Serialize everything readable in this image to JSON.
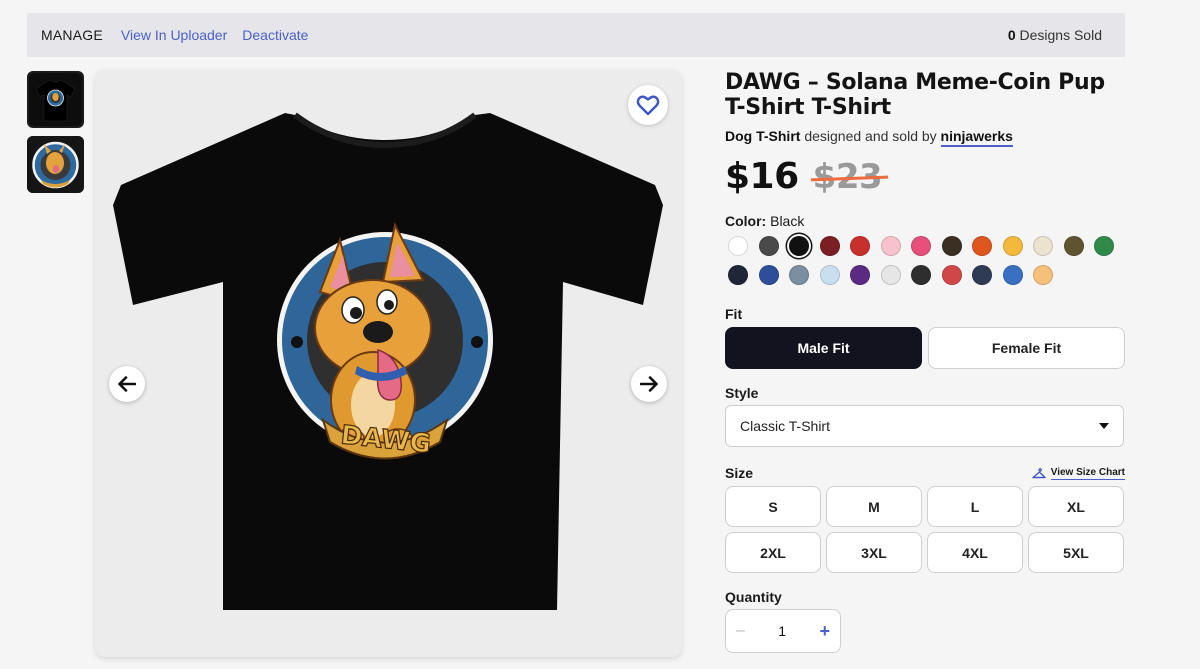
{
  "manage_bar": {
    "manage_label": "MANAGE",
    "view_uploader_label": "View In Uploader",
    "deactivate_label": "Deactivate",
    "designs_sold_count": "0",
    "designs_sold_label": "Designs Sold"
  },
  "product": {
    "title": "DAWG – Solana Meme-Coin Pup T-Shirt T-Shirt",
    "product_type": "Dog T-Shirt",
    "designed_by_text": "designed and sold by",
    "artist": "ninjawerks",
    "price_now": "$16",
    "price_was": "$23",
    "design_text": "DAWG"
  },
  "color": {
    "label": "Color:",
    "selected": "Black",
    "swatches": [
      "#ffffff",
      "#4a4a4a",
      "#111111",
      "#7a1f24",
      "#c8302c",
      "#f6c3cc",
      "#e6507a",
      "#3b2e22",
      "#e0561f",
      "#f2b93b",
      "#ebe3cf",
      "#5e5530",
      "#2f8a4a",
      "#1e2638",
      "#2d4f9a",
      "#7c8fa0",
      "#c9dff0",
      "#5b2b83",
      "#e6e6e6",
      "#2e2e2e",
      "#d04748",
      "#2f3a55",
      "#3a6fc2",
      "#f4c07a"
    ],
    "selected_index": 2
  },
  "fit": {
    "label": "Fit",
    "options": [
      "Male Fit",
      "Female Fit"
    ],
    "selected": "Male Fit"
  },
  "style": {
    "label": "Style",
    "selected": "Classic T-Shirt"
  },
  "size": {
    "label": "Size",
    "chart_link": "View Size Chart",
    "options": [
      "S",
      "M",
      "L",
      "XL",
      "2XL",
      "3XL",
      "4XL",
      "5XL"
    ]
  },
  "quantity": {
    "label": "Quantity",
    "value": "1",
    "minus": "–",
    "plus": "+"
  },
  "icons": {
    "favorite": "heart-icon",
    "previous": "arrow-left-icon",
    "next": "arrow-right-icon",
    "size_chart": "hanger-icon"
  },
  "colors": {
    "accent": "#4a5fc9",
    "strike": "#ee6b3b",
    "primary_button": "#13131f"
  }
}
